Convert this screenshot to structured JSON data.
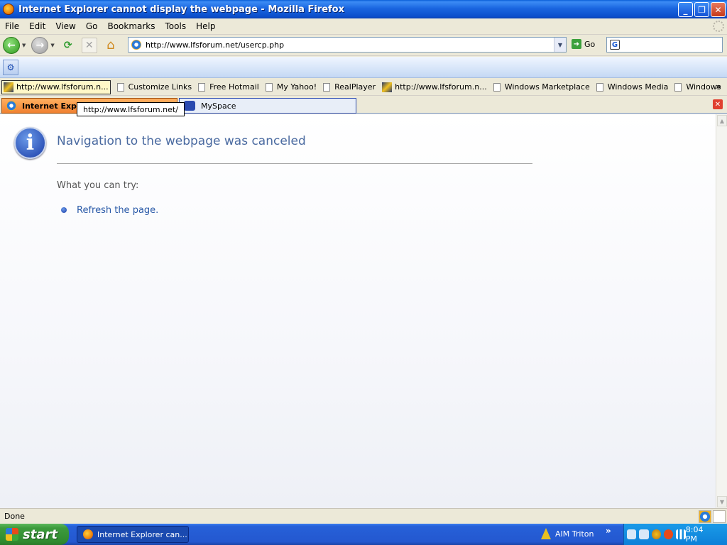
{
  "window": {
    "title": "Internet Explorer cannot display the webpage - Mozilla Firefox",
    "minimize": "_",
    "maximize": "❐",
    "close": "✕"
  },
  "menu": {
    "items": [
      "File",
      "Edit",
      "View",
      "Go",
      "Bookmarks",
      "Tools",
      "Help"
    ]
  },
  "nav": {
    "url": "http://www.lfsforum.net/usercp.php",
    "go_label": "Go",
    "search_value": ""
  },
  "bookmarks": {
    "items": [
      "http://www.lfsforum.n...",
      "Customize Links",
      "Free Hotmail",
      "My Yahoo!",
      "RealPlayer",
      "http://www.lfsforum.n...",
      "Windows Marketplace",
      "Windows Media",
      "Windows"
    ],
    "overflow": "»"
  },
  "tabs": {
    "active_label": "Internet Explo",
    "inactive_label": "MySpace"
  },
  "tooltip": "http://www.lfsforum.net/",
  "content": {
    "heading": "Navigation to the webpage was canceled",
    "try_label": "What you can try:",
    "refresh_link": "Refresh the page."
  },
  "status": {
    "text": "Done"
  },
  "taskbar": {
    "start_label": "start",
    "window_button": "Internet Explorer can...",
    "aim_label": "AIM Triton",
    "clock": "8:04 PM"
  },
  "icons": {
    "app": "firefox-icon",
    "info": "info-icon",
    "accent": "#4a6aa0"
  }
}
